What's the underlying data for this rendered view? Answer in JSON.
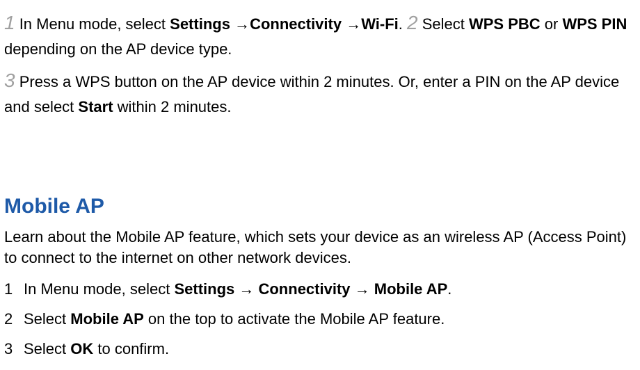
{
  "steps": {
    "s1": {
      "num": "1",
      "t0": " In Menu mode, select ",
      "b1": "Settings",
      "a1": " →",
      "b2": "Connectivity",
      "a2": " →",
      "b3": "Wi-Fi",
      "t1": ". "
    },
    "s2": {
      "num": "2",
      "t0": " Select ",
      "b1": "WPS PBC",
      "t1": " or ",
      "b2": "WPS PIN",
      "t2": " depending on the AP device type."
    },
    "s3": {
      "num": "3",
      "t0": " Press a WPS button on the AP device within 2 minutes. Or, enter a PIN on the AP device and select ",
      "b1": "Start",
      "t1": " within 2 minutes."
    }
  },
  "heading": "Mobile AP",
  "intro": "Learn about the Mobile AP feature, which sets your device as an wireless AP (Access Point) to connect to the internet on other network devices.",
  "olist": {
    "i1": {
      "num": "1",
      "t0": "In Menu mode, select ",
      "b1": "Settings",
      "a1": " → ",
      "b2": "Connectivity",
      "a2": " → ",
      "b3": "Mobile AP",
      "t1": "."
    },
    "i2": {
      "num": "2",
      "t0": "Select ",
      "b1": "Mobile AP",
      "t1": " on the top to activate the Mobile AP feature."
    },
    "i3": {
      "num": "3",
      "t0": "Select ",
      "b1": "OK",
      "t1": " to confirm."
    }
  }
}
